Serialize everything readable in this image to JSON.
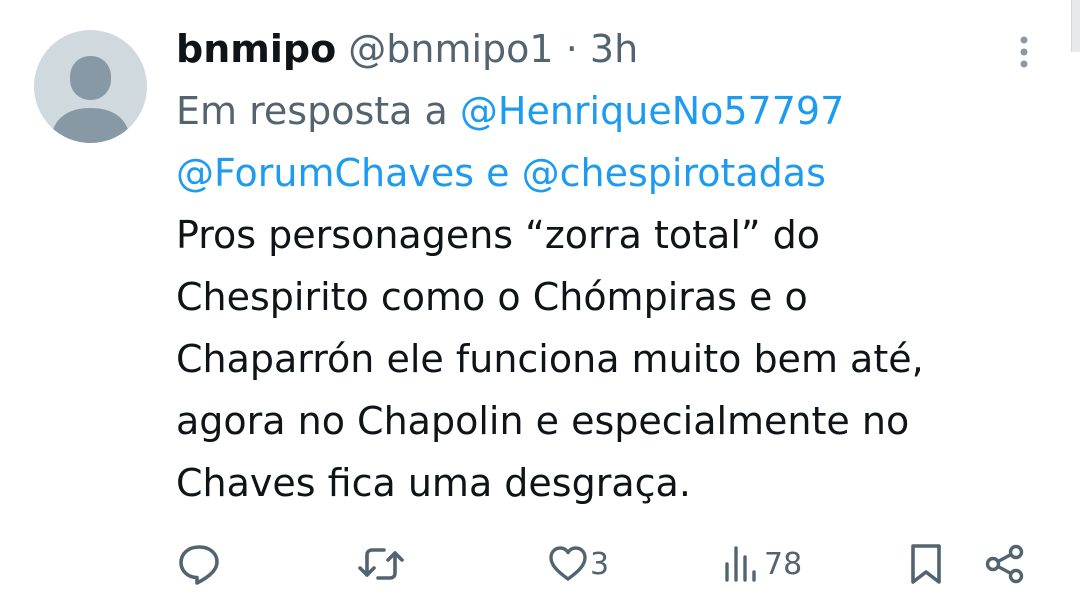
{
  "tweet": {
    "display_name": "bnmipo",
    "handle": "@bnmipo1",
    "separator": "·",
    "time": "3h",
    "reply_prefix": "Em resposta a",
    "reply_to_1": "@HenriqueNo57797",
    "reply_to_2": "@ForumChaves",
    "reply_conj": "e",
    "reply_to_3": "@chespirotadas",
    "body_lines": [
      "Pros personagens “zorra total” do",
      "Chespirito como o Chómpiras e o",
      "Chaparrón ele funciona muito bem até,",
      "agora no Chapolin e especialmente no",
      "Chaves fica uma desgraça."
    ]
  },
  "actions": {
    "reply_icon": "reply-icon",
    "retweet_icon": "retweet-icon",
    "like_icon": "heart-icon",
    "like_count": "3",
    "views_icon": "views-icon",
    "views_count": "78",
    "bookmark_icon": "bookmark-icon",
    "share_icon": "share-icon",
    "more_icon": "more-vertical-icon"
  },
  "colors": {
    "accent": "#1d9bf0",
    "secondary_text": "#536471",
    "primary_text": "#0f1419",
    "avatar_bg": "#cfd9de",
    "avatar_fg": "#8899a6"
  }
}
